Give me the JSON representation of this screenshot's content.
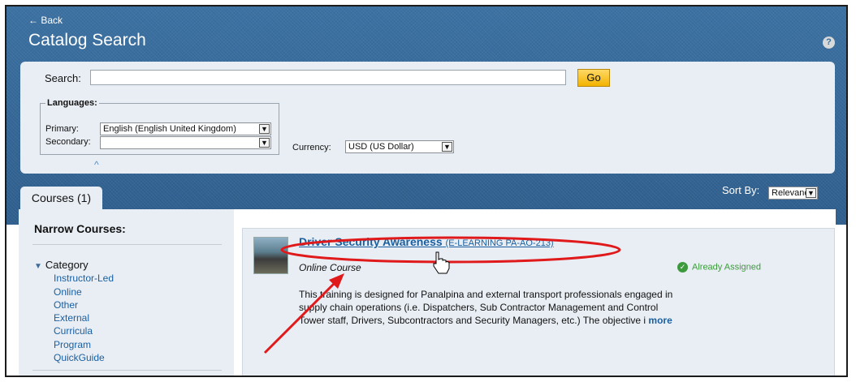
{
  "header": {
    "back_label": "← Back",
    "title": "Catalog Search",
    "help_icon": "?"
  },
  "search": {
    "label": "Search:",
    "value": "",
    "go_label": "Go"
  },
  "languages": {
    "legend": "Languages:",
    "primary_label": "Primary:",
    "primary_value": "English (English United Kingdom)",
    "secondary_label": "Secondary:",
    "secondary_value": "",
    "collapse_icon": "^"
  },
  "currency": {
    "label": "Currency:",
    "value": "USD (US Dollar)"
  },
  "tabs": {
    "courses_label": "Courses (1)"
  },
  "sort": {
    "label": "Sort By:",
    "value": "Relevance"
  },
  "narrow": {
    "title": "Narrow Courses:",
    "category_label": "Category",
    "items": [
      "Instructor-Led",
      "Online",
      "Other",
      "External",
      "Curricula",
      "Program",
      "QuickGuide"
    ]
  },
  "course": {
    "title": "Driver Security Awareness",
    "code": "(E-LEARNING PA-AO-213)",
    "type": "Online Course",
    "status": "Already Assigned",
    "description": "This training is designed for Panalpina and external transport professionals engaged in supply chain operations (i.e. Dispatchers, Sub Contractor Management and Control Tower staff, Drivers, Subcontractors and Security Managers, etc.) The objective i",
    "more_label": "more"
  },
  "colors": {
    "header_blue": "#3a6d9b",
    "panel_bg": "#e9eef4",
    "link_blue": "#1a5f9f",
    "go_yellow": "#f2b300",
    "assigned_green": "#3c9a3c",
    "annotation_red": "#e0191b"
  }
}
